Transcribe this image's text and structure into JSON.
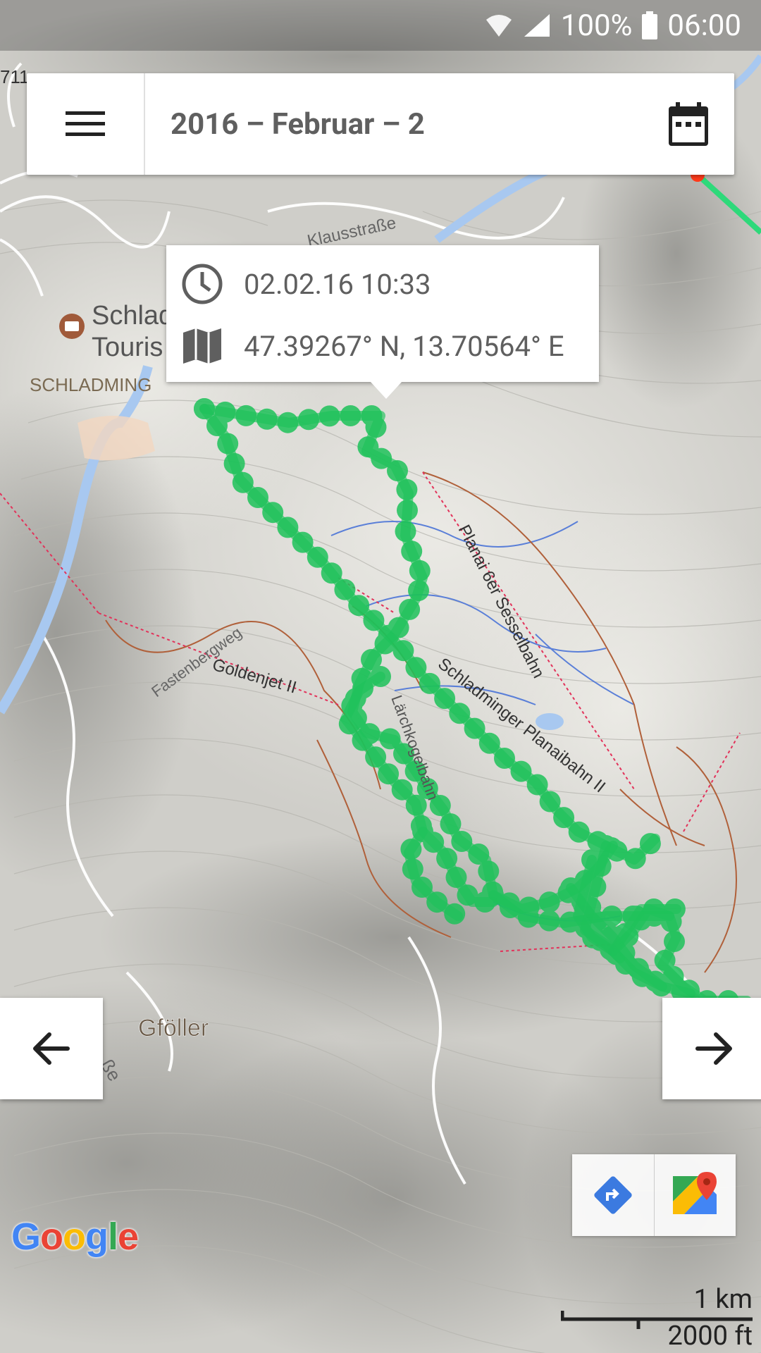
{
  "status_bar": {
    "battery": "100%",
    "time": "06:00"
  },
  "header": {
    "title": "2016 – Februar – 2"
  },
  "info_popup": {
    "timestamp": "02.02.16 10:33",
    "coordinates": "47.39267° N, 13.70564° E"
  },
  "map": {
    "labels": {
      "town_1": "Schlad",
      "town_2": "Touris",
      "schladming": "SCHLADMING",
      "road_711": "711",
      "klausstrasse": "Klausstraße",
      "lift_planai": "Planai 6er Sesselbahn",
      "lift_goldenjet": "Goldenjet II",
      "lift_schladminger": "Schladminger Planaibahn II",
      "lift_laerchkogel": "Lärchkogelbahn",
      "fastenbergweg": "Fastenbergweg",
      "gfoeller": "Gföller",
      "road_se": "ße"
    },
    "track_color": "#1ec25a",
    "attribution": "Google"
  },
  "scale_bar": {
    "metric": "1 km",
    "imperial": "2000 ft"
  },
  "icons": {
    "menu": "hamburger-menu-icon",
    "calendar": "calendar-icon",
    "clock": "clock-icon",
    "map": "map-icon",
    "prev": "arrow-left-icon",
    "next": "arrow-right-icon",
    "directions": "directions-icon",
    "google_maps": "google-maps-icon"
  }
}
